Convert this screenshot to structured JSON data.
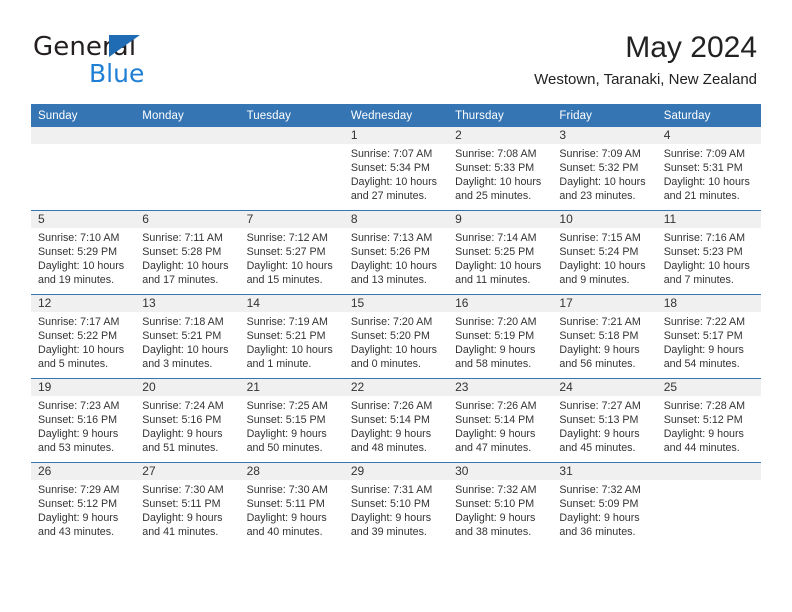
{
  "brand": {
    "name_part1": "General",
    "name_part2": "Blue",
    "accent_color": "#1f7fd4",
    "triangle_color": "#1f6cb4"
  },
  "header": {
    "title": "May 2024",
    "subtitle": "Westown, Taranaki, New Zealand"
  },
  "calendar": {
    "header_bg": "#3575b4",
    "daynum_bg": "#f0f0f0",
    "weekdays": [
      "Sunday",
      "Monday",
      "Tuesday",
      "Wednesday",
      "Thursday",
      "Friday",
      "Saturday"
    ],
    "weeks": [
      [
        {
          "day": ""
        },
        {
          "day": ""
        },
        {
          "day": ""
        },
        {
          "day": "1",
          "sunrise": "Sunrise: 7:07 AM",
          "sunset": "Sunset: 5:34 PM",
          "daylight_line1": "Daylight: 10 hours",
          "daylight_line2": "and 27 minutes."
        },
        {
          "day": "2",
          "sunrise": "Sunrise: 7:08 AM",
          "sunset": "Sunset: 5:33 PM",
          "daylight_line1": "Daylight: 10 hours",
          "daylight_line2": "and 25 minutes."
        },
        {
          "day": "3",
          "sunrise": "Sunrise: 7:09 AM",
          "sunset": "Sunset: 5:32 PM",
          "daylight_line1": "Daylight: 10 hours",
          "daylight_line2": "and 23 minutes."
        },
        {
          "day": "4",
          "sunrise": "Sunrise: 7:09 AM",
          "sunset": "Sunset: 5:31 PM",
          "daylight_line1": "Daylight: 10 hours",
          "daylight_line2": "and 21 minutes."
        }
      ],
      [
        {
          "day": "5",
          "sunrise": "Sunrise: 7:10 AM",
          "sunset": "Sunset: 5:29 PM",
          "daylight_line1": "Daylight: 10 hours",
          "daylight_line2": "and 19 minutes."
        },
        {
          "day": "6",
          "sunrise": "Sunrise: 7:11 AM",
          "sunset": "Sunset: 5:28 PM",
          "daylight_line1": "Daylight: 10 hours",
          "daylight_line2": "and 17 minutes."
        },
        {
          "day": "7",
          "sunrise": "Sunrise: 7:12 AM",
          "sunset": "Sunset: 5:27 PM",
          "daylight_line1": "Daylight: 10 hours",
          "daylight_line2": "and 15 minutes."
        },
        {
          "day": "8",
          "sunrise": "Sunrise: 7:13 AM",
          "sunset": "Sunset: 5:26 PM",
          "daylight_line1": "Daylight: 10 hours",
          "daylight_line2": "and 13 minutes."
        },
        {
          "day": "9",
          "sunrise": "Sunrise: 7:14 AM",
          "sunset": "Sunset: 5:25 PM",
          "daylight_line1": "Daylight: 10 hours",
          "daylight_line2": "and 11 minutes."
        },
        {
          "day": "10",
          "sunrise": "Sunrise: 7:15 AM",
          "sunset": "Sunset: 5:24 PM",
          "daylight_line1": "Daylight: 10 hours",
          "daylight_line2": "and 9 minutes."
        },
        {
          "day": "11",
          "sunrise": "Sunrise: 7:16 AM",
          "sunset": "Sunset: 5:23 PM",
          "daylight_line1": "Daylight: 10 hours",
          "daylight_line2": "and 7 minutes."
        }
      ],
      [
        {
          "day": "12",
          "sunrise": "Sunrise: 7:17 AM",
          "sunset": "Sunset: 5:22 PM",
          "daylight_line1": "Daylight: 10 hours",
          "daylight_line2": "and 5 minutes."
        },
        {
          "day": "13",
          "sunrise": "Sunrise: 7:18 AM",
          "sunset": "Sunset: 5:21 PM",
          "daylight_line1": "Daylight: 10 hours",
          "daylight_line2": "and 3 minutes."
        },
        {
          "day": "14",
          "sunrise": "Sunrise: 7:19 AM",
          "sunset": "Sunset: 5:21 PM",
          "daylight_line1": "Daylight: 10 hours",
          "daylight_line2": "and 1 minute."
        },
        {
          "day": "15",
          "sunrise": "Sunrise: 7:20 AM",
          "sunset": "Sunset: 5:20 PM",
          "daylight_line1": "Daylight: 10 hours",
          "daylight_line2": "and 0 minutes."
        },
        {
          "day": "16",
          "sunrise": "Sunrise: 7:20 AM",
          "sunset": "Sunset: 5:19 PM",
          "daylight_line1": "Daylight: 9 hours",
          "daylight_line2": "and 58 minutes."
        },
        {
          "day": "17",
          "sunrise": "Sunrise: 7:21 AM",
          "sunset": "Sunset: 5:18 PM",
          "daylight_line1": "Daylight: 9 hours",
          "daylight_line2": "and 56 minutes."
        },
        {
          "day": "18",
          "sunrise": "Sunrise: 7:22 AM",
          "sunset": "Sunset: 5:17 PM",
          "daylight_line1": "Daylight: 9 hours",
          "daylight_line2": "and 54 minutes."
        }
      ],
      [
        {
          "day": "19",
          "sunrise": "Sunrise: 7:23 AM",
          "sunset": "Sunset: 5:16 PM",
          "daylight_line1": "Daylight: 9 hours",
          "daylight_line2": "and 53 minutes."
        },
        {
          "day": "20",
          "sunrise": "Sunrise: 7:24 AM",
          "sunset": "Sunset: 5:16 PM",
          "daylight_line1": "Daylight: 9 hours",
          "daylight_line2": "and 51 minutes."
        },
        {
          "day": "21",
          "sunrise": "Sunrise: 7:25 AM",
          "sunset": "Sunset: 5:15 PM",
          "daylight_line1": "Daylight: 9 hours",
          "daylight_line2": "and 50 minutes."
        },
        {
          "day": "22",
          "sunrise": "Sunrise: 7:26 AM",
          "sunset": "Sunset: 5:14 PM",
          "daylight_line1": "Daylight: 9 hours",
          "daylight_line2": "and 48 minutes."
        },
        {
          "day": "23",
          "sunrise": "Sunrise: 7:26 AM",
          "sunset": "Sunset: 5:14 PM",
          "daylight_line1": "Daylight: 9 hours",
          "daylight_line2": "and 47 minutes."
        },
        {
          "day": "24",
          "sunrise": "Sunrise: 7:27 AM",
          "sunset": "Sunset: 5:13 PM",
          "daylight_line1": "Daylight: 9 hours",
          "daylight_line2": "and 45 minutes."
        },
        {
          "day": "25",
          "sunrise": "Sunrise: 7:28 AM",
          "sunset": "Sunset: 5:12 PM",
          "daylight_line1": "Daylight: 9 hours",
          "daylight_line2": "and 44 minutes."
        }
      ],
      [
        {
          "day": "26",
          "sunrise": "Sunrise: 7:29 AM",
          "sunset": "Sunset: 5:12 PM",
          "daylight_line1": "Daylight: 9 hours",
          "daylight_line2": "and 43 minutes."
        },
        {
          "day": "27",
          "sunrise": "Sunrise: 7:30 AM",
          "sunset": "Sunset: 5:11 PM",
          "daylight_line1": "Daylight: 9 hours",
          "daylight_line2": "and 41 minutes."
        },
        {
          "day": "28",
          "sunrise": "Sunrise: 7:30 AM",
          "sunset": "Sunset: 5:11 PM",
          "daylight_line1": "Daylight: 9 hours",
          "daylight_line2": "and 40 minutes."
        },
        {
          "day": "29",
          "sunrise": "Sunrise: 7:31 AM",
          "sunset": "Sunset: 5:10 PM",
          "daylight_line1": "Daylight: 9 hours",
          "daylight_line2": "and 39 minutes."
        },
        {
          "day": "30",
          "sunrise": "Sunrise: 7:32 AM",
          "sunset": "Sunset: 5:10 PM",
          "daylight_line1": "Daylight: 9 hours",
          "daylight_line2": "and 38 minutes."
        },
        {
          "day": "31",
          "sunrise": "Sunrise: 7:32 AM",
          "sunset": "Sunset: 5:09 PM",
          "daylight_line1": "Daylight: 9 hours",
          "daylight_line2": "and 36 minutes."
        },
        {
          "day": ""
        }
      ]
    ]
  }
}
